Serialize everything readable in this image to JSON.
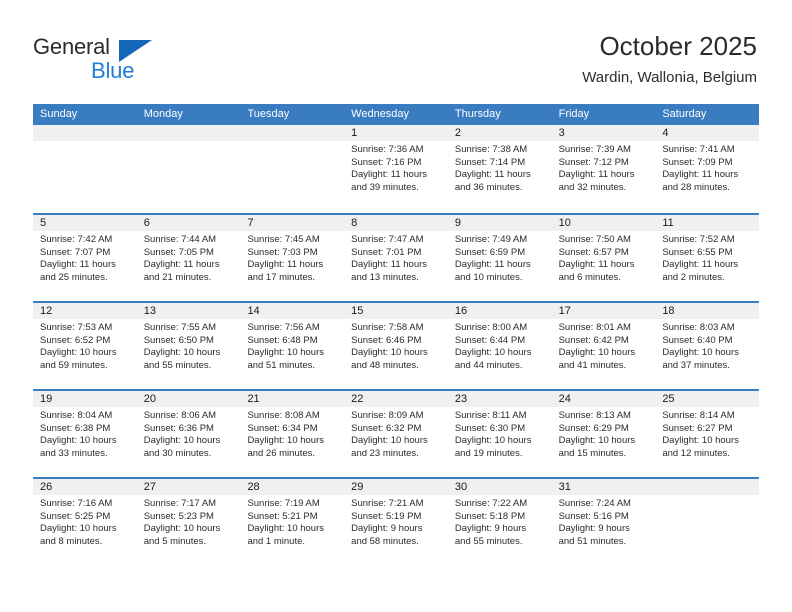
{
  "brand": {
    "name_part1": "General",
    "name_part2": "Blue",
    "accent_color": "#1f7fd6",
    "triangle_color": "#1565b8"
  },
  "header": {
    "month_year": "October 2025",
    "location": "Wardin, Wallonia, Belgium",
    "header_bg": "#3a7cc0",
    "daynum_bg": "#f0f0f0"
  },
  "weekdays": [
    "Sunday",
    "Monday",
    "Tuesday",
    "Wednesday",
    "Thursday",
    "Friday",
    "Saturday"
  ],
  "weeks": [
    [
      {
        "day": "",
        "sunrise": "",
        "sunset": "",
        "daylight": "",
        "empty": true
      },
      {
        "day": "",
        "sunrise": "",
        "sunset": "",
        "daylight": "",
        "empty": true
      },
      {
        "day": "",
        "sunrise": "",
        "sunset": "",
        "daylight": "",
        "empty": true
      },
      {
        "day": "1",
        "sunrise": "Sunrise: 7:36 AM",
        "sunset": "Sunset: 7:16 PM",
        "daylight": "Daylight: 11 hours and 39 minutes.",
        "empty": false
      },
      {
        "day": "2",
        "sunrise": "Sunrise: 7:38 AM",
        "sunset": "Sunset: 7:14 PM",
        "daylight": "Daylight: 11 hours and 36 minutes.",
        "empty": false
      },
      {
        "day": "3",
        "sunrise": "Sunrise: 7:39 AM",
        "sunset": "Sunset: 7:12 PM",
        "daylight": "Daylight: 11 hours and 32 minutes.",
        "empty": false
      },
      {
        "day": "4",
        "sunrise": "Sunrise: 7:41 AM",
        "sunset": "Sunset: 7:09 PM",
        "daylight": "Daylight: 11 hours and 28 minutes.",
        "empty": false
      }
    ],
    [
      {
        "day": "5",
        "sunrise": "Sunrise: 7:42 AM",
        "sunset": "Sunset: 7:07 PM",
        "daylight": "Daylight: 11 hours and 25 minutes.",
        "empty": false
      },
      {
        "day": "6",
        "sunrise": "Sunrise: 7:44 AM",
        "sunset": "Sunset: 7:05 PM",
        "daylight": "Daylight: 11 hours and 21 minutes.",
        "empty": false
      },
      {
        "day": "7",
        "sunrise": "Sunrise: 7:45 AM",
        "sunset": "Sunset: 7:03 PM",
        "daylight": "Daylight: 11 hours and 17 minutes.",
        "empty": false
      },
      {
        "day": "8",
        "sunrise": "Sunrise: 7:47 AM",
        "sunset": "Sunset: 7:01 PM",
        "daylight": "Daylight: 11 hours and 13 minutes.",
        "empty": false
      },
      {
        "day": "9",
        "sunrise": "Sunrise: 7:49 AM",
        "sunset": "Sunset: 6:59 PM",
        "daylight": "Daylight: 11 hours and 10 minutes.",
        "empty": false
      },
      {
        "day": "10",
        "sunrise": "Sunrise: 7:50 AM",
        "sunset": "Sunset: 6:57 PM",
        "daylight": "Daylight: 11 hours and 6 minutes.",
        "empty": false
      },
      {
        "day": "11",
        "sunrise": "Sunrise: 7:52 AM",
        "sunset": "Sunset: 6:55 PM",
        "daylight": "Daylight: 11 hours and 2 minutes.",
        "empty": false
      }
    ],
    [
      {
        "day": "12",
        "sunrise": "Sunrise: 7:53 AM",
        "sunset": "Sunset: 6:52 PM",
        "daylight": "Daylight: 10 hours and 59 minutes.",
        "empty": false
      },
      {
        "day": "13",
        "sunrise": "Sunrise: 7:55 AM",
        "sunset": "Sunset: 6:50 PM",
        "daylight": "Daylight: 10 hours and 55 minutes.",
        "empty": false
      },
      {
        "day": "14",
        "sunrise": "Sunrise: 7:56 AM",
        "sunset": "Sunset: 6:48 PM",
        "daylight": "Daylight: 10 hours and 51 minutes.",
        "empty": false
      },
      {
        "day": "15",
        "sunrise": "Sunrise: 7:58 AM",
        "sunset": "Sunset: 6:46 PM",
        "daylight": "Daylight: 10 hours and 48 minutes.",
        "empty": false
      },
      {
        "day": "16",
        "sunrise": "Sunrise: 8:00 AM",
        "sunset": "Sunset: 6:44 PM",
        "daylight": "Daylight: 10 hours and 44 minutes.",
        "empty": false
      },
      {
        "day": "17",
        "sunrise": "Sunrise: 8:01 AM",
        "sunset": "Sunset: 6:42 PM",
        "daylight": "Daylight: 10 hours and 41 minutes.",
        "empty": false
      },
      {
        "day": "18",
        "sunrise": "Sunrise: 8:03 AM",
        "sunset": "Sunset: 6:40 PM",
        "daylight": "Daylight: 10 hours and 37 minutes.",
        "empty": false
      }
    ],
    [
      {
        "day": "19",
        "sunrise": "Sunrise: 8:04 AM",
        "sunset": "Sunset: 6:38 PM",
        "daylight": "Daylight: 10 hours and 33 minutes.",
        "empty": false
      },
      {
        "day": "20",
        "sunrise": "Sunrise: 8:06 AM",
        "sunset": "Sunset: 6:36 PM",
        "daylight": "Daylight: 10 hours and 30 minutes.",
        "empty": false
      },
      {
        "day": "21",
        "sunrise": "Sunrise: 8:08 AM",
        "sunset": "Sunset: 6:34 PM",
        "daylight": "Daylight: 10 hours and 26 minutes.",
        "empty": false
      },
      {
        "day": "22",
        "sunrise": "Sunrise: 8:09 AM",
        "sunset": "Sunset: 6:32 PM",
        "daylight": "Daylight: 10 hours and 23 minutes.",
        "empty": false
      },
      {
        "day": "23",
        "sunrise": "Sunrise: 8:11 AM",
        "sunset": "Sunset: 6:30 PM",
        "daylight": "Daylight: 10 hours and 19 minutes.",
        "empty": false
      },
      {
        "day": "24",
        "sunrise": "Sunrise: 8:13 AM",
        "sunset": "Sunset: 6:29 PM",
        "daylight": "Daylight: 10 hours and 15 minutes.",
        "empty": false
      },
      {
        "day": "25",
        "sunrise": "Sunrise: 8:14 AM",
        "sunset": "Sunset: 6:27 PM",
        "daylight": "Daylight: 10 hours and 12 minutes.",
        "empty": false
      }
    ],
    [
      {
        "day": "26",
        "sunrise": "Sunrise: 7:16 AM",
        "sunset": "Sunset: 5:25 PM",
        "daylight": "Daylight: 10 hours and 8 minutes.",
        "empty": false
      },
      {
        "day": "27",
        "sunrise": "Sunrise: 7:17 AM",
        "sunset": "Sunset: 5:23 PM",
        "daylight": "Daylight: 10 hours and 5 minutes.",
        "empty": false
      },
      {
        "day": "28",
        "sunrise": "Sunrise: 7:19 AM",
        "sunset": "Sunset: 5:21 PM",
        "daylight": "Daylight: 10 hours and 1 minute.",
        "empty": false
      },
      {
        "day": "29",
        "sunrise": "Sunrise: 7:21 AM",
        "sunset": "Sunset: 5:19 PM",
        "daylight": "Daylight: 9 hours and 58 minutes.",
        "empty": false
      },
      {
        "day": "30",
        "sunrise": "Sunrise: 7:22 AM",
        "sunset": "Sunset: 5:18 PM",
        "daylight": "Daylight: 9 hours and 55 minutes.",
        "empty": false
      },
      {
        "day": "31",
        "sunrise": "Sunrise: 7:24 AM",
        "sunset": "Sunset: 5:16 PM",
        "daylight": "Daylight: 9 hours and 51 minutes.",
        "empty": false
      },
      {
        "day": "",
        "sunrise": "",
        "sunset": "",
        "daylight": "",
        "empty": true
      }
    ]
  ]
}
